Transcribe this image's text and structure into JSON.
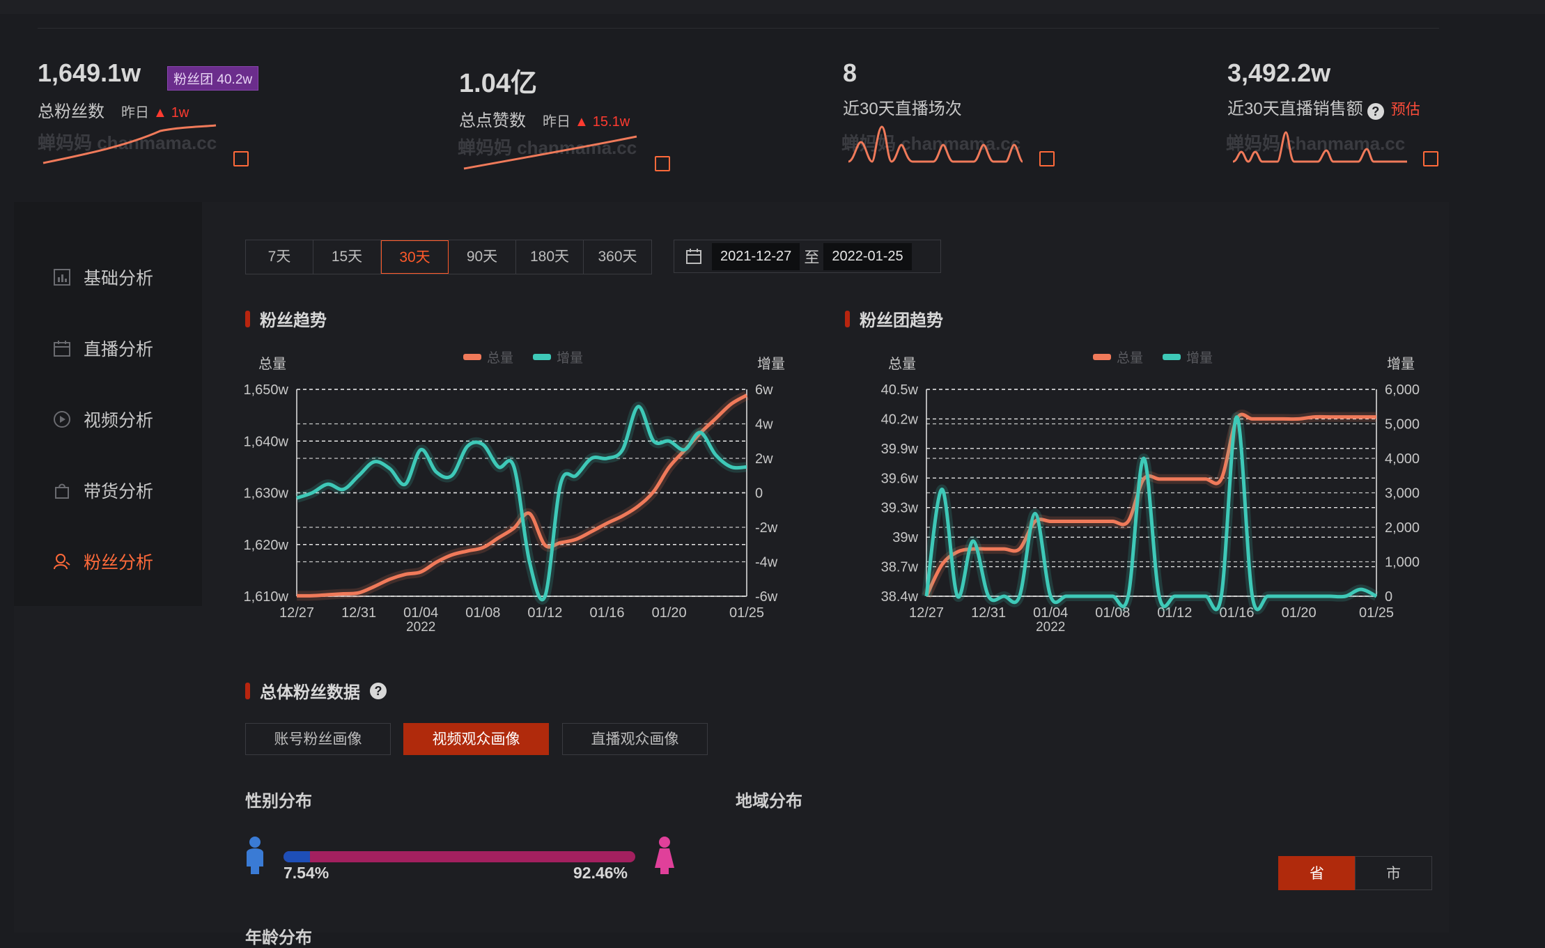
{
  "stats": [
    {
      "value": "1,649.1w",
      "label": "总粉丝数",
      "yest_label": "昨日",
      "yest_value": "1w",
      "badge": "粉丝团 40.2w"
    },
    {
      "value": "1.04亿",
      "label": "总点赞数",
      "yest_label": "昨日",
      "yest_value": "15.1w"
    },
    {
      "value": "8",
      "label": "近30天直播场次"
    },
    {
      "value": "3,492.2w",
      "label": "近30天直播销售额",
      "help": "?",
      "note": "预估"
    }
  ],
  "watermark": "蝉妈妈 chanmama.cc",
  "sidebar": {
    "items": [
      {
        "label": "基础分析",
        "icon": "bar-chart-icon",
        "active": false
      },
      {
        "label": "直播分析",
        "icon": "calendar-icon",
        "active": false
      },
      {
        "label": "视频分析",
        "icon": "play-icon",
        "active": false
      },
      {
        "label": "带货分析",
        "icon": "bag-icon",
        "active": false
      },
      {
        "label": "粉丝分析",
        "icon": "user-icon",
        "active": true
      }
    ]
  },
  "range_buttons": [
    {
      "label": "7天",
      "active": false
    },
    {
      "label": "15天",
      "active": false
    },
    {
      "label": "30天",
      "active": true
    },
    {
      "label": "90天",
      "active": false
    },
    {
      "label": "180天",
      "active": false
    },
    {
      "label": "360天",
      "active": false
    }
  ],
  "date_range": {
    "start": "2021-12-27",
    "sep": "至",
    "end": "2022-01-25"
  },
  "sections": {
    "fans_trend": "粉丝趋势",
    "fan_club_trend": "粉丝团趋势",
    "overall": "总体粉丝数据",
    "overall_help": "?",
    "gender": "性别分布",
    "region": "地域分布",
    "age": "年龄分布"
  },
  "portrait_tabs": [
    {
      "label": "账号粉丝画像",
      "active": false
    },
    {
      "label": "视频观众画像",
      "active": true
    },
    {
      "label": "直播观众画像",
      "active": false
    }
  ],
  "gender": {
    "male_pct": "7.54%",
    "female_pct": "92.46%",
    "male_value": 7.54,
    "female_value": 92.46,
    "male_color": "#1e4fb8",
    "female_color": "#a3205f"
  },
  "region_toggle": [
    {
      "label": "省",
      "active": true
    },
    {
      "label": "市",
      "active": false
    }
  ],
  "colors": {
    "accent": "#ff5a2a",
    "total": "#f07a5a",
    "increase": "#3ec9b8"
  },
  "chart_data": [
    {
      "type": "line",
      "title": "粉丝趋势",
      "left_axis_label": "总量",
      "right_axis_label": "增量",
      "legend": [
        "总量",
        "增量"
      ],
      "x_ticks": [
        "12/27",
        "12/31",
        "01/04",
        "01/08",
        "01/12",
        "01/16",
        "01/20",
        "01/25"
      ],
      "x_sub_label": "2022",
      "y_left_ticks": [
        "1,610w",
        "1,620w",
        "1,630w",
        "1,640w",
        "1,650w"
      ],
      "y_right_ticks": [
        "-6w",
        "-4w",
        "-2w",
        "0",
        "2w",
        "4w",
        "6w"
      ],
      "ylim_left": [
        1607.5,
        1650
      ],
      "ylim_right": [
        -6,
        6
      ],
      "x": [
        "12/27",
        "12/28",
        "12/29",
        "12/30",
        "12/31",
        "01/01",
        "01/02",
        "01/03",
        "01/04",
        "01/05",
        "01/06",
        "01/07",
        "01/08",
        "01/09",
        "01/10",
        "01/11",
        "01/12",
        "01/13",
        "01/14",
        "01/15",
        "01/16",
        "01/17",
        "01/18",
        "01/19",
        "01/20",
        "01/21",
        "01/22",
        "01/23",
        "01/24",
        "01/25"
      ],
      "series": [
        {
          "name": "总量",
          "axis": "left",
          "values": [
            1607.6,
            1607.6,
            1607.8,
            1608,
            1608.2,
            1609.5,
            1611,
            1612,
            1612.5,
            1614.5,
            1616,
            1616.8,
            1617.5,
            1619.5,
            1621.5,
            1624.5,
            1618,
            1618.5,
            1619.2,
            1620.8,
            1622.5,
            1624,
            1626,
            1629,
            1634,
            1637.5,
            1641,
            1644,
            1647,
            1648.8
          ]
        },
        {
          "name": "增量",
          "axis": "right",
          "values": [
            -0.3,
            0,
            0.5,
            0.2,
            1,
            1.8,
            1.4,
            0.5,
            2.5,
            1.2,
            1,
            2.7,
            2.8,
            1.5,
            1.5,
            -4,
            -6,
            0.5,
            1,
            2,
            2,
            2.5,
            5,
            3,
            3,
            2.5,
            3.5,
            2.2,
            1.5,
            1.5
          ]
        }
      ]
    },
    {
      "type": "line",
      "title": "粉丝团趋势",
      "left_axis_label": "总量",
      "right_axis_label": "增量",
      "legend": [
        "总量",
        "增量"
      ],
      "x_ticks": [
        "12/27",
        "12/31",
        "01/04",
        "01/08",
        "01/12",
        "01/16",
        "01/20",
        "01/25"
      ],
      "x_sub_label": "2022",
      "y_left_ticks": [
        "38.4w",
        "38.7w",
        "39w",
        "39.3w",
        "39.6w",
        "39.9w",
        "40.2w",
        "40.5w"
      ],
      "y_right_ticks": [
        "0",
        "1,000",
        "2,000",
        "3,000",
        "4,000",
        "5,000",
        "6,000"
      ],
      "ylim_left": [
        38.4,
        40.5
      ],
      "ylim_right": [
        0,
        6000
      ],
      "x": [
        "12/27",
        "12/28",
        "12/29",
        "12/30",
        "12/31",
        "01/01",
        "01/02",
        "01/03",
        "01/04",
        "01/05",
        "01/06",
        "01/07",
        "01/08",
        "01/09",
        "01/10",
        "01/11",
        "01/12",
        "01/13",
        "01/14",
        "01/15",
        "01/16",
        "01/17",
        "01/18",
        "01/19",
        "01/20",
        "01/21",
        "01/22",
        "01/23",
        "01/24",
        "01/25"
      ],
      "series": [
        {
          "name": "总量",
          "axis": "left",
          "values": [
            38.4,
            38.72,
            38.85,
            38.88,
            38.88,
            38.88,
            38.88,
            39.16,
            39.16,
            39.16,
            39.16,
            39.16,
            39.16,
            39.16,
            39.59,
            39.59,
            39.59,
            39.59,
            39.59,
            39.59,
            40.2,
            40.2,
            40.2,
            40.2,
            40.2,
            40.22,
            40.22,
            40.22,
            40.22,
            40.22
          ]
        },
        {
          "name": "增量",
          "axis": "left",
          "values": [
            0,
            3100,
            0,
            1600,
            0,
            0,
            0,
            2400,
            0,
            0,
            0,
            0,
            0,
            0,
            4000,
            0,
            0,
            0,
            0,
            0,
            5200,
            0,
            0,
            0,
            0,
            0,
            0,
            0,
            200,
            0
          ]
        }
      ]
    }
  ]
}
